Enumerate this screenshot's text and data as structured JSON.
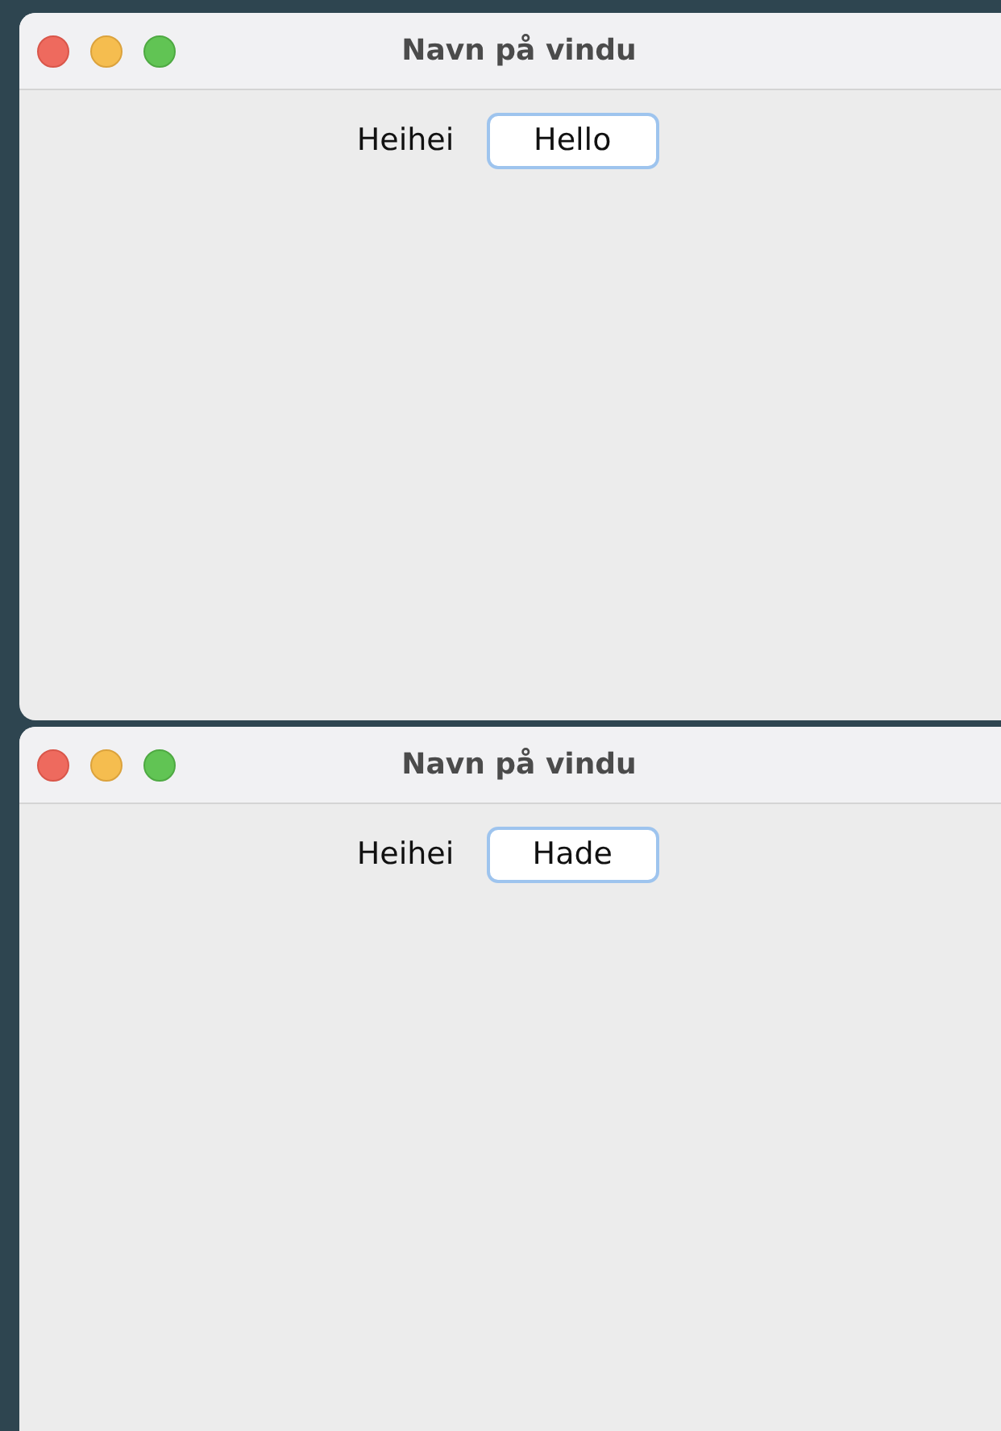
{
  "windows": [
    {
      "title": "Navn på vindu",
      "label": "Heihei",
      "button": "Hello"
    },
    {
      "title": "Navn på vindu",
      "label": "Heihei",
      "button": "Hade"
    }
  ]
}
